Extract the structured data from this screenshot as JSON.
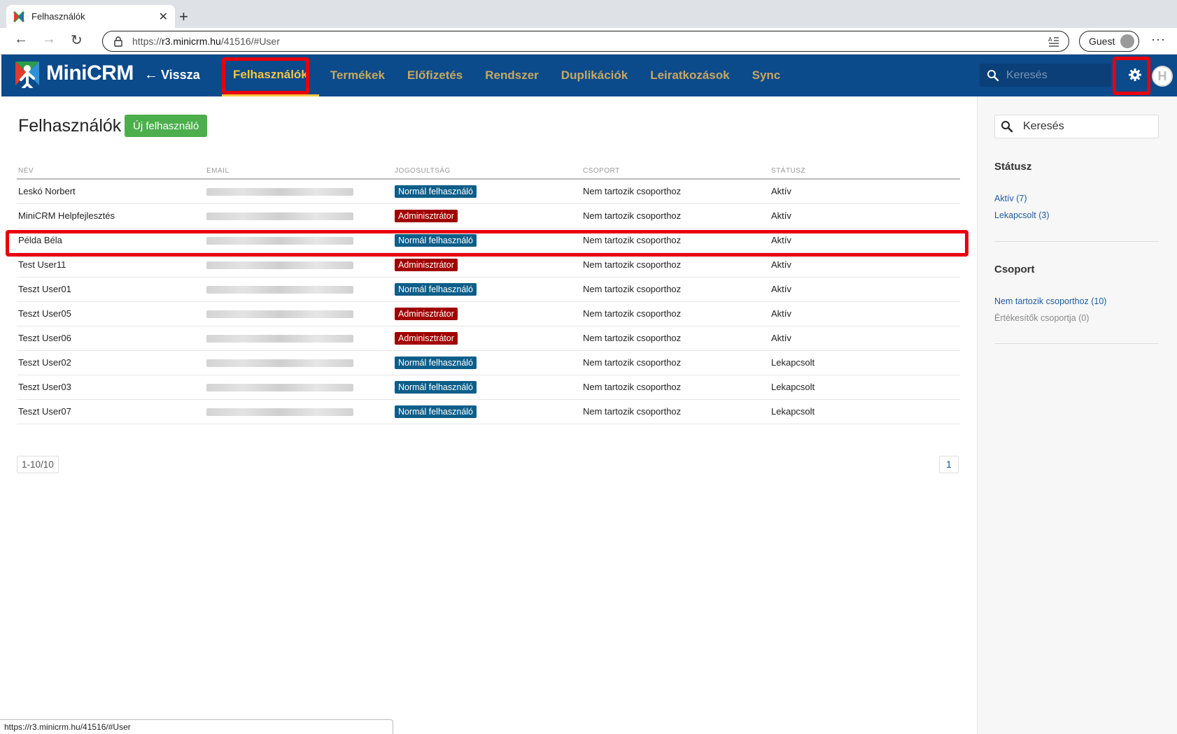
{
  "browser": {
    "tab_title": "Felhasználók",
    "url_prefix": "https://",
    "url_host": "r3.minicrm.hu",
    "url_path": "/41516/#User",
    "profile_label": "Guest",
    "status_url": "https://r3.minicrm.hu/41516/#User"
  },
  "app": {
    "logo_text": "MiniCRM",
    "back_label": "Vissza",
    "nav": [
      "Felhasználók",
      "Termékek",
      "Előfizetés",
      "Rendszer",
      "Duplikációk",
      "Leiratkozások",
      "Sync"
    ],
    "search_placeholder": "Keresés",
    "avatar_initial": "H",
    "colors": {
      "header": "#0b4a8b",
      "nav_active": "#f5c542",
      "nav": "#c8a860",
      "highlight": "#e8000e"
    }
  },
  "main": {
    "title": "Felhasználók",
    "new_button": "Új felhasználó",
    "columns": [
      "NÉV",
      "EMAIL",
      "JOGOSULTSÁG",
      "CSOPORT",
      "STÁTUSZ"
    ],
    "rows": [
      {
        "name": "Leskó Norbert",
        "role": "Normál felhasználó",
        "role_type": "normal",
        "group": "Nem tartozik csoporthoz",
        "status": "Aktív"
      },
      {
        "name": "MiniCRM Helpfejlesztés",
        "role": "Adminisztrátor",
        "role_type": "admin",
        "group": "Nem tartozik csoporthoz",
        "status": "Aktív"
      },
      {
        "name": "Példa Béla",
        "role": "Normál felhasználó",
        "role_type": "normal",
        "group": "Nem tartozik csoporthoz",
        "status": "Aktív"
      },
      {
        "name": "Test User11",
        "role": "Adminisztrátor",
        "role_type": "admin",
        "group": "Nem tartozik csoporthoz",
        "status": "Aktív"
      },
      {
        "name": "Teszt User01",
        "role": "Normál felhasználó",
        "role_type": "normal",
        "group": "Nem tartozik csoporthoz",
        "status": "Aktív"
      },
      {
        "name": "Teszt User05",
        "role": "Adminisztrátor",
        "role_type": "admin",
        "group": "Nem tartozik csoporthoz",
        "status": "Aktív"
      },
      {
        "name": "Teszt User06",
        "role": "Adminisztrátor",
        "role_type": "admin",
        "group": "Nem tartozik csoporthoz",
        "status": "Aktív"
      },
      {
        "name": "Teszt User02",
        "role": "Normál felhasználó",
        "role_type": "normal",
        "group": "Nem tartozik csoporthoz",
        "status": "Lekapcsolt"
      },
      {
        "name": "Teszt User03",
        "role": "Normál felhasználó",
        "role_type": "normal",
        "group": "Nem tartozik csoporthoz",
        "status": "Lekapcsolt"
      },
      {
        "name": "Teszt User07",
        "role": "Normál felhasználó",
        "role_type": "normal",
        "group": "Nem tartozik csoporthoz",
        "status": "Lekapcsolt"
      }
    ],
    "pager_range": "1-10/10",
    "pager_page": "1"
  },
  "sidebar": {
    "search_placeholder": "Keresés",
    "status_heading": "Státusz",
    "status_links": [
      "Aktív (7)",
      "Lekapcsolt (3)"
    ],
    "group_heading": "Csoport",
    "group_links": [
      "Nem tartozik csoporthoz (10)",
      "Értékesítők csoportja (0)"
    ]
  }
}
